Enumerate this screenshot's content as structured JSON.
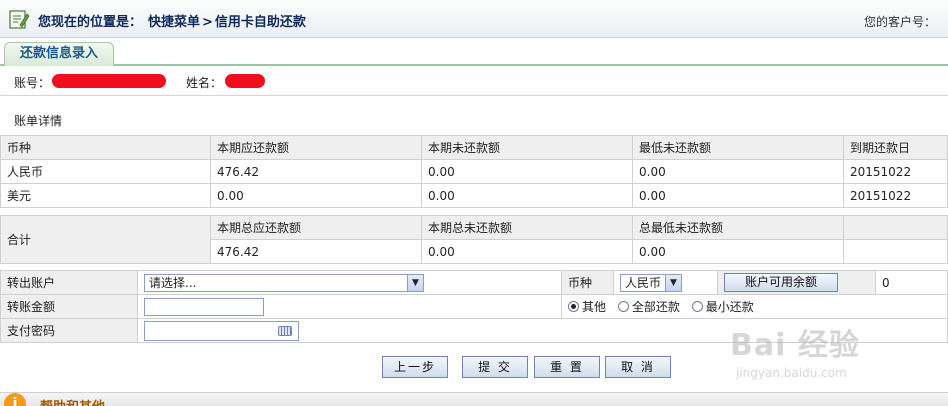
{
  "header": {
    "location_label": "您现在的位置是：",
    "crumb_menu": "快捷菜单",
    "crumb_sep": ">",
    "crumb_page": "信用卡自助还款",
    "customer_label": "您的客户号："
  },
  "tab": {
    "label": "还款信息录入"
  },
  "account": {
    "account_label": "账号：",
    "name_label": "姓名："
  },
  "bill": {
    "section_title": "账单详情",
    "headers": [
      "币种",
      "本期应还款额",
      "本期未还款额",
      "最低未还款额",
      "到期还款日"
    ],
    "rows": [
      [
        "人民币",
        "476.42",
        "0.00",
        "0.00",
        "20151022"
      ],
      [
        "美元",
        "0.00",
        "0.00",
        "0.00",
        "20151022"
      ]
    ]
  },
  "total": {
    "label": "合计",
    "headers": [
      "本期总应还款额",
      "本期总未还款额",
      "总最低未还款额"
    ],
    "values": [
      "476.42",
      "0.00",
      "0.00"
    ]
  },
  "form": {
    "from_account_label": "转出账户",
    "from_account_value": "请选择...",
    "currency_label": "币种",
    "currency_value": "人民币",
    "balance_button": "账户可用余额",
    "balance_value": "0",
    "amount_label": "转账金额",
    "radio_other": "其他",
    "radio_full": "全部还款",
    "radio_min": "最小还款",
    "password_label": "支付密码"
  },
  "buttons": {
    "prev": "上一步",
    "submit": "提 交",
    "reset": "重 置",
    "cancel": "取 消"
  },
  "help": {
    "title": "帮助和其他"
  },
  "watermark": {
    "brand": "Bai 经验",
    "url": "jingyan.baidu.com"
  }
}
